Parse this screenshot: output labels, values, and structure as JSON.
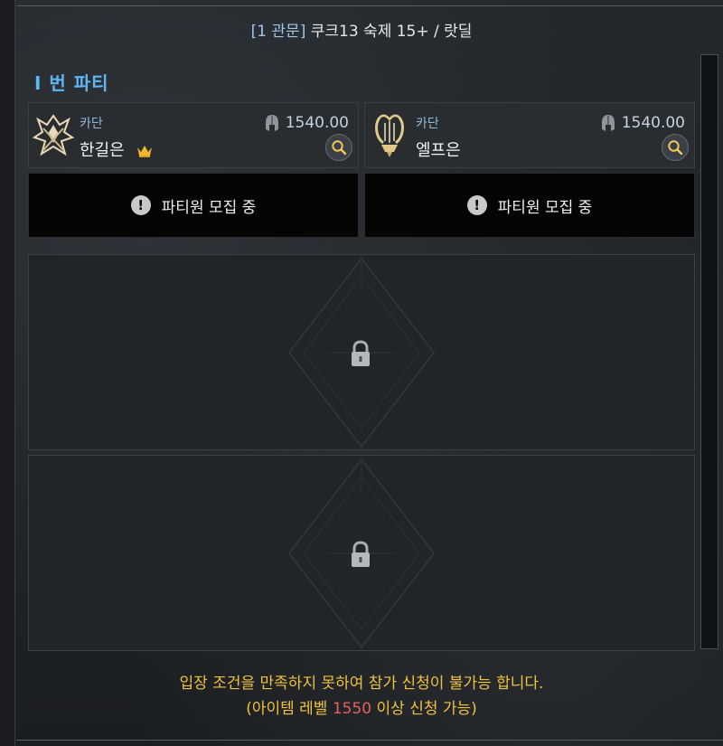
{
  "header": {
    "tag": "[1 관문]",
    "title": "쿠크13 숙제 15+ / 랏딜"
  },
  "party": {
    "title": "I 번 파티",
    "members": [
      {
        "server": "카단",
        "name": "한길은",
        "item_level": "1540.00",
        "is_leader": true,
        "class_icon": "destroyer-emblem-icon"
      },
      {
        "server": "카단",
        "name": "엘프은",
        "item_level": "1540.00",
        "is_leader": false,
        "class_icon": "lyre-bard-emblem-icon"
      }
    ],
    "recruiting": [
      {
        "label": "파티원 모집 중"
      },
      {
        "label": "파티원 모집 중"
      }
    ]
  },
  "notice": {
    "line1": "입장 조건을 만족하지 못하여 참가 신청이 불가능 합니다.",
    "line2_prefix": "(아이템 레벨 ",
    "line2_level": "1550",
    "line2_suffix": " 이상 신청 가능)"
  },
  "colors": {
    "accent_blue": "#5fb6f2",
    "notice_yellow": "#f0c23c",
    "required_level_red": "#e8605a"
  }
}
